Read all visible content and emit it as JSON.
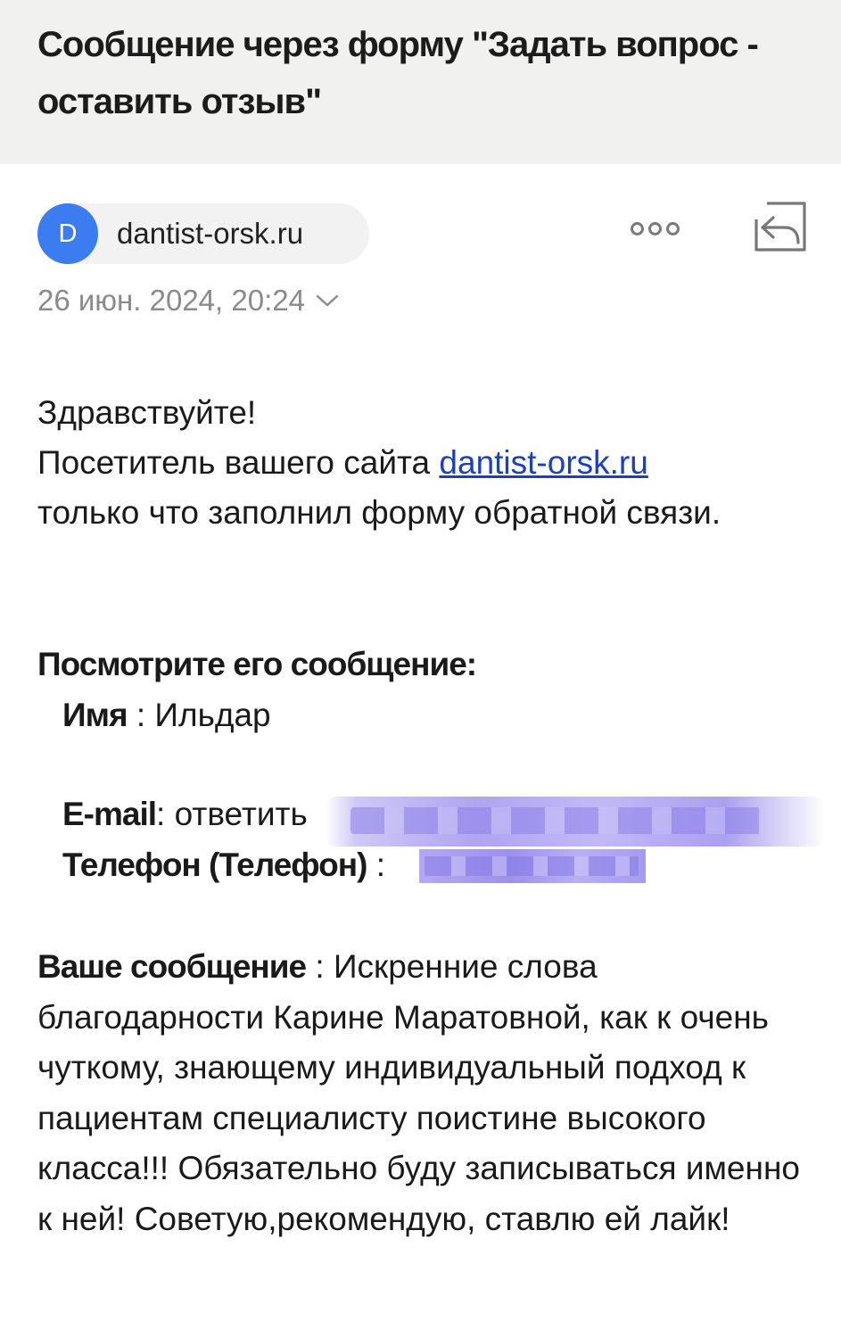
{
  "header": {
    "subject": "Сообщение через форму \"Задать вопрос - оставить отзыв\""
  },
  "sender": {
    "avatar_letter": "D",
    "name": "dantist-orsk.ru",
    "avatar_color": "#3b7df0"
  },
  "actions": {
    "more_icon": "more-horizontal-icon",
    "reply_icon": "reply-icon"
  },
  "date": {
    "text": "26 июн. 2024, 20:24"
  },
  "body": {
    "greeting": "Здравствуйте!",
    "intro_before_link": "Посетитель вашего сайта ",
    "link_text": "dantist-orsk.ru",
    "intro_after_link": "только что заполнил форму обратной связи.",
    "heading": "Посмотрите его сообщение:",
    "name_label": "Имя",
    "name_separator": " : ",
    "name_value": "Ильдар",
    "email_label": "E-mail",
    "email_separator": ": ",
    "email_value": "ответить",
    "phone_label": "Телефон (Телефон)",
    "phone_separator": " : ",
    "message_label": "Ваше сообщение",
    "message_separator": " : ",
    "message_text": "Искренние слова благодарности Карине Маратовной, как к очень чуткому, знающему индивидуальный подход к пациентам специалисту поистине высокого класса!!! Обязательно буду записываться именно к ней! Советую,рекомендую, ставлю ей лайк!"
  },
  "colors": {
    "link": "#1a3fc4",
    "header_bg": "#f1f1ef",
    "muted_text": "#8a8a8a"
  }
}
